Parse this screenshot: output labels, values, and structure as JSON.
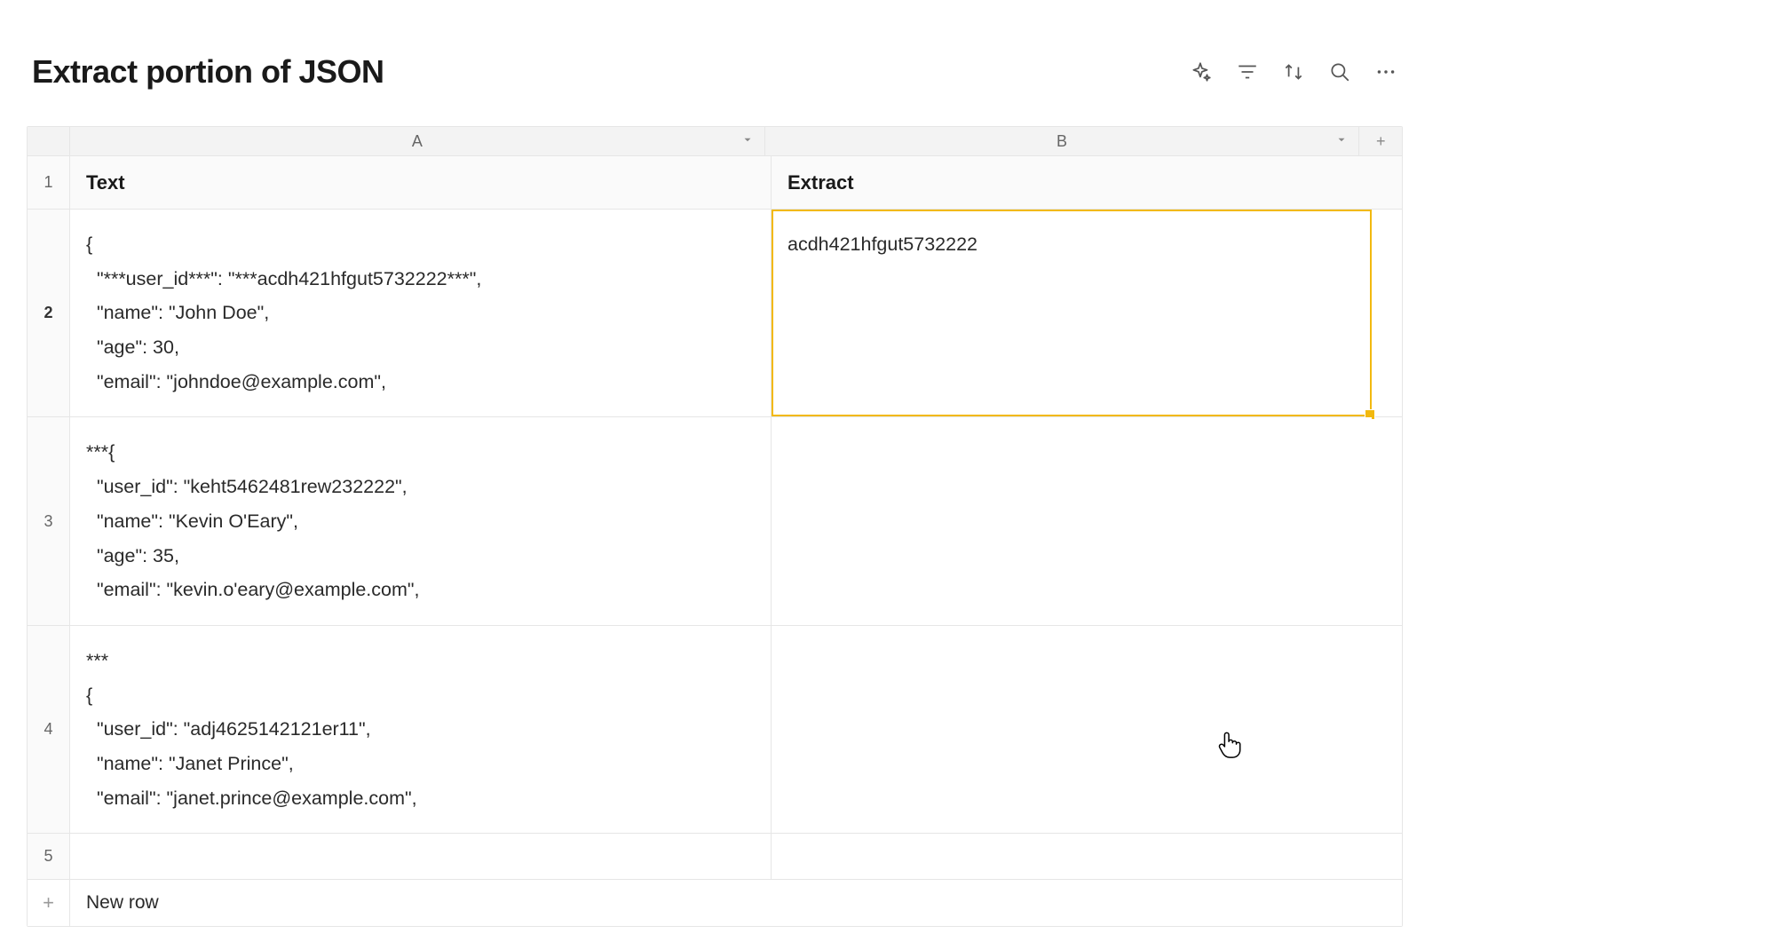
{
  "title": "Extract portion of JSON",
  "columns": {
    "a": {
      "letter": "A",
      "header": "Text"
    },
    "b": {
      "letter": "B",
      "header": "Extract"
    }
  },
  "rows": [
    {
      "num": "1"
    },
    {
      "num": "2",
      "text": "{\n  \"***user_id***\": \"***acdh421hfgut5732222***\",\n  \"name\": \"John Doe\",\n  \"age\": 30,\n  \"email\": \"johndoe@example.com\",",
      "extract": "acdh421hfgut5732222",
      "selected": true
    },
    {
      "num": "3",
      "text": "***{\n  \"user_id\": \"keht5462481rew232222\",\n  \"name\": \"Kevin O'Eary\",\n  \"age\": 35,\n  \"email\": \"kevin.o'eary@example.com\",",
      "extract": ""
    },
    {
      "num": "4",
      "text": "***\n{\n  \"user_id\": \"adj4625142121er11\",\n  \"name\": \"Janet Prince\",\n  \"email\": \"janet.prince@example.com\",",
      "extract": ""
    },
    {
      "num": "5",
      "text": "",
      "extract": ""
    }
  ],
  "newRowLabel": "New row",
  "plus": "+"
}
